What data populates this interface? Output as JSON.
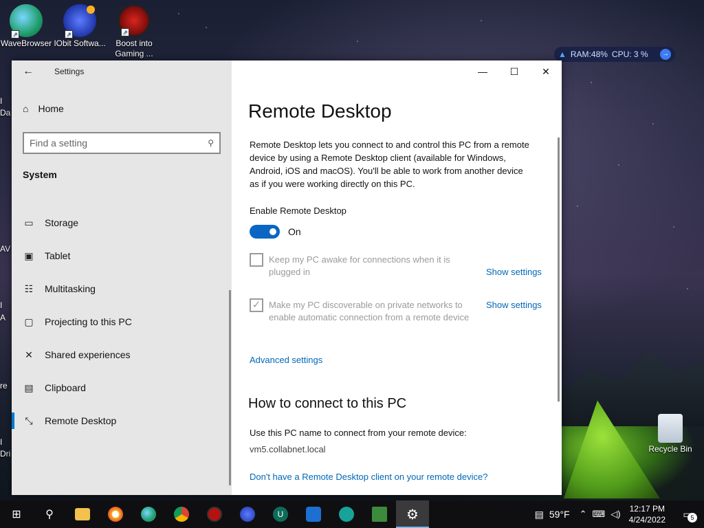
{
  "desktop": {
    "icons": [
      {
        "label": "WaveBrowser"
      },
      {
        "label": "IObit Softwa..."
      },
      {
        "label": "Boost into Gaming ..."
      },
      {
        "label": "Recycle Bin"
      }
    ],
    "left_fragments": [
      "I",
      "Da",
      "AV",
      "I",
      "A",
      "re",
      "I",
      "Dri"
    ],
    "ram_widget": {
      "ram": "RAM:48%",
      "cpu": "CPU: 3 %"
    }
  },
  "window": {
    "title": "Settings",
    "controls": {
      "minimize": "—",
      "maximize": "☐",
      "close": "✕"
    }
  },
  "sidebar": {
    "home_label": "Home",
    "search_placeholder": "Find a setting",
    "section_title": "System",
    "items": [
      {
        "label": "Storage"
      },
      {
        "label": "Tablet"
      },
      {
        "label": "Multitasking"
      },
      {
        "label": "Projecting to this PC"
      },
      {
        "label": "Shared experiences"
      },
      {
        "label": "Clipboard"
      },
      {
        "label": "Remote Desktop"
      }
    ]
  },
  "main": {
    "title": "Remote Desktop",
    "description": "Remote Desktop lets you connect to and control this PC from a remote device by using a Remote Desktop client (available for Windows, Android, iOS and macOS). You'll be able to work from another device as if you were working directly on this PC.",
    "enable_label": "Enable Remote Desktop",
    "toggle_state": "On",
    "toggle_on": true,
    "options": [
      {
        "text": "Keep my PC awake for connections when it is plugged in",
        "checked": false,
        "link": "Show settings"
      },
      {
        "text": "Make my PC discoverable on private networks to enable automatic connection from a remote device",
        "checked": true,
        "link": "Show settings"
      }
    ],
    "advanced_link": "Advanced settings",
    "connect_heading": "How to connect to this PC",
    "connect_text": "Use this PC name to connect from your remote device:",
    "pc_name": "vm5.collabnet.local",
    "client_link": "Don't have a Remote Desktop client on your remote device?"
  },
  "taskbar": {
    "apps": [
      "start-icon",
      "search-icon",
      "file-explorer-icon",
      "brave-icon",
      "edge-icon",
      "chrome-icon",
      "security-app-icon",
      "iobit-icon",
      "ucheck-icon",
      "shield-app-icon",
      "vpn-icon",
      "task-manager-icon",
      "settings-icon"
    ],
    "temperature": "59°F",
    "time": "12:17 PM",
    "date": "4/24/2022",
    "notification_count": "5"
  },
  "colors": {
    "accent": "#0078d7",
    "link": "#0067b8",
    "toggle": "#0a66c2"
  }
}
